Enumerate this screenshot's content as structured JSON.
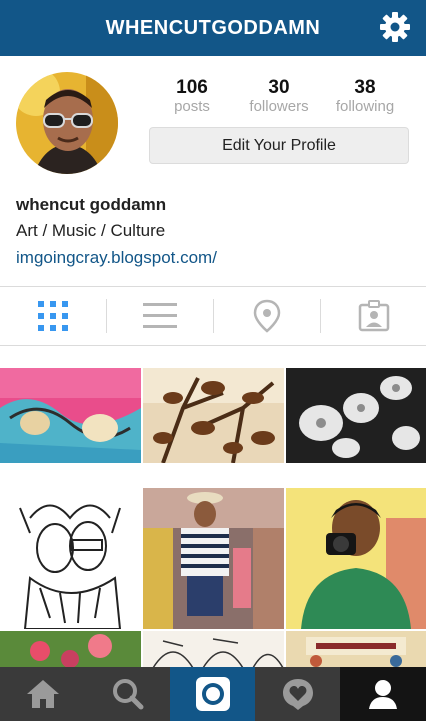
{
  "header": {
    "title": "WHENCUTGODDAMN"
  },
  "profile": {
    "posts_count": "106",
    "posts_label": "posts",
    "followers_count": "30",
    "followers_label": "followers",
    "following_count": "38",
    "following_label": "following",
    "edit_button_label": "Edit Your Profile",
    "full_name": "whencut goddamn",
    "bio": "Art / Music / Culture",
    "website": "imgoingcray.blogspot.com/"
  },
  "view_tabs": [
    {
      "icon": "grid-icon",
      "active": true
    },
    {
      "icon": "list-icon",
      "active": false
    },
    {
      "icon": "location-pin-icon",
      "active": false
    },
    {
      "icon": "tagged-photos-icon",
      "active": false
    }
  ],
  "bottom_nav": [
    {
      "icon": "home-icon"
    },
    {
      "icon": "search-icon"
    },
    {
      "icon": "camera-icon",
      "active": true
    },
    {
      "icon": "activity-heart-icon"
    },
    {
      "icon": "profile-icon"
    }
  ],
  "colors": {
    "brand": "#125688",
    "tab_active": "#3897f0",
    "tab_inactive": "#b5b5b5",
    "bottom_bar": "#3a3a3a",
    "stat_label": "#a7a7a7"
  }
}
